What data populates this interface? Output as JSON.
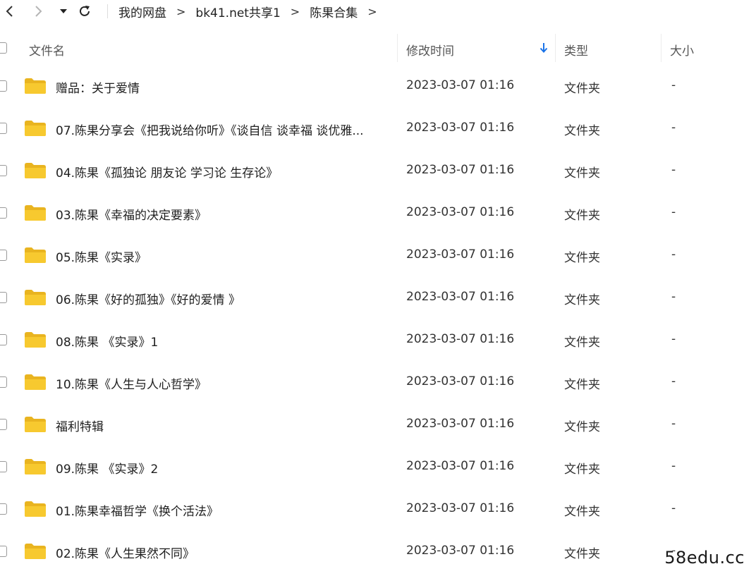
{
  "breadcrumb": [
    "我的网盘",
    "bk41.net共享1",
    "陈果合集"
  ],
  "breadcrumb_separator": ">",
  "columns": {
    "name": "文件名",
    "modified": "修改时间",
    "type": "类型",
    "size": "大小"
  },
  "sort_icon": "arrow-down-icon",
  "accent_color": "#1a73e8",
  "folder_color": "#f7c92f",
  "files": [
    {
      "name": "赠品：关于爱情",
      "modified": "2023-03-07 01:16",
      "type": "文件夹",
      "size": "-"
    },
    {
      "name": "07.陈果分享会《把我说给你听》《谈自信 谈幸福 谈优雅...",
      "modified": "2023-03-07 01:16",
      "type": "文件夹",
      "size": "-"
    },
    {
      "name": "04.陈果《孤独论 朋友论 学习论 生存论》",
      "modified": "2023-03-07 01:16",
      "type": "文件夹",
      "size": "-"
    },
    {
      "name": "03.陈果《幸福的决定要素》",
      "modified": "2023-03-07 01:16",
      "type": "文件夹",
      "size": "-"
    },
    {
      "name": "05.陈果《实录》",
      "modified": "2023-03-07 01:16",
      "type": "文件夹",
      "size": "-"
    },
    {
      "name": "06.陈果《好的孤独》《好的爱情 》",
      "modified": "2023-03-07 01:16",
      "type": "文件夹",
      "size": "-"
    },
    {
      "name": "08.陈果 《实录》1",
      "modified": "2023-03-07 01:16",
      "type": "文件夹",
      "size": "-"
    },
    {
      "name": "10.陈果《人生与人心哲学》",
      "modified": "2023-03-07 01:16",
      "type": "文件夹",
      "size": "-"
    },
    {
      "name": "福利特辑",
      "modified": "2023-03-07 01:16",
      "type": "文件夹",
      "size": "-"
    },
    {
      "name": "09.陈果 《实录》2",
      "modified": "2023-03-07 01:16",
      "type": "文件夹",
      "size": "-"
    },
    {
      "name": "01.陈果幸福哲学《换个活法》",
      "modified": "2023-03-07 01:16",
      "type": "文件夹",
      "size": "-"
    },
    {
      "name": "02.陈果《人生果然不同》",
      "modified": "2023-03-07 01:16",
      "type": "文件夹",
      "size": "-"
    }
  ],
  "watermark": "58edu.cc"
}
